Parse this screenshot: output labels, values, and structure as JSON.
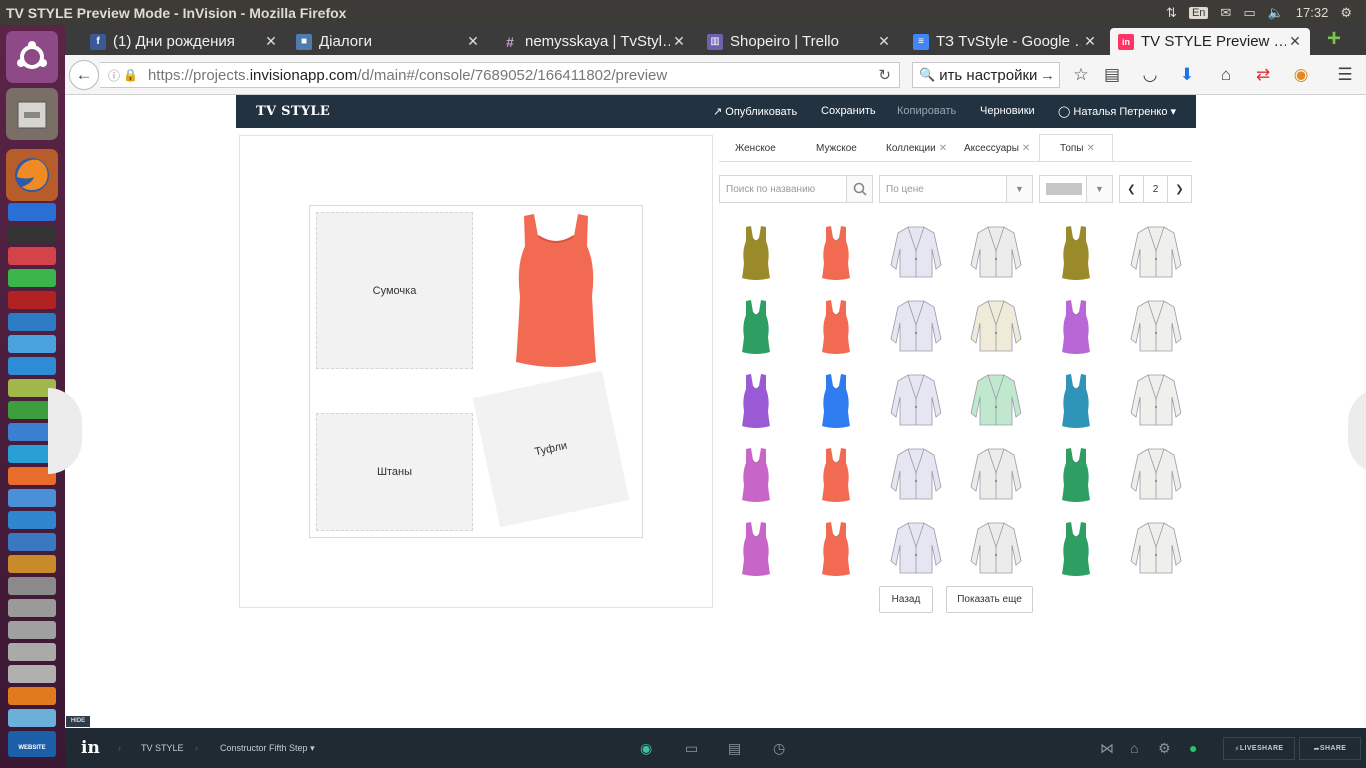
{
  "os": {
    "window_title": "TV STYLE Preview Mode - InVision - Mozilla Firefox",
    "keyboard_layout": "En",
    "clock": "17:32"
  },
  "launcher": {
    "icons": [
      "ubuntu-dash-icon",
      "files-icon",
      "firefox-icon",
      "webstorm-icon",
      "terminal-icon",
      "filezilla-icon",
      "libreoffice-icon",
      "software-center-icon",
      "website-copier-icon"
    ],
    "bottom_label": "WEBSITE COPIER"
  },
  "browser": {
    "tabs": [
      {
        "label": "(1) Дни рождения",
        "icon": "facebook-icon",
        "color": "#3b5998",
        "glyph": "f"
      },
      {
        "label": "Діалоги",
        "icon": "chat-icon",
        "color": "#4f7cae",
        "glyph": "■"
      },
      {
        "label": "nemysskaya | TvStyl…",
        "icon": "slack-icon",
        "color": "#6b4a6b",
        "glyph": "#"
      },
      {
        "label": "Shopeiro | Trello",
        "icon": "trello-icon",
        "color": "#7060b0",
        "glyph": "▥"
      },
      {
        "label": "ТЗ TvStyle - Google …",
        "icon": "google-docs-icon",
        "color": "#4285f4",
        "glyph": "≡"
      },
      {
        "label": "TV STYLE Preview …",
        "icon": "invision-icon",
        "color": "#ff3366",
        "glyph": "in"
      }
    ],
    "url_prefix": "https://projects.",
    "url_host": "invisionapp.com",
    "url_path": "/d/main#/console/7689052/166411802/preview",
    "search_value": "ить настройки"
  },
  "app": {
    "logo": "TV STYLE",
    "header": {
      "publish": "Опубликовать",
      "save": "Сохранить",
      "copy": "Копировать",
      "drafts": "Черновики",
      "user": "Наталья Петренко"
    },
    "slots": {
      "bag": "Сумочка",
      "pants": "Штаны",
      "shoes": "Туфли"
    },
    "categories": [
      {
        "label": "Женское",
        "closable": false
      },
      {
        "label": "Мужское",
        "closable": false
      },
      {
        "label": "Коллекции",
        "closable": true
      },
      {
        "label": "Аксессуары",
        "closable": true
      },
      {
        "label": "Топы",
        "closable": true
      }
    ],
    "filters": {
      "search_placeholder": "Поиск по названию",
      "price_placeholder": "По цене",
      "color_value": "#c6c6c6"
    },
    "pager": {
      "page": "2"
    },
    "grid": [
      [
        {
          "type": "tank",
          "color": "#9a8a2a"
        },
        {
          "type": "tank",
          "color": "#f26a52"
        },
        {
          "type": "blazer",
          "color": "#e6e6f2"
        },
        {
          "type": "blazer",
          "color": "#ececea"
        },
        {
          "type": "tank",
          "color": "#9a8a2a"
        },
        {
          "type": "blazer",
          "color": "#efefec"
        }
      ],
      [
        {
          "type": "tank",
          "color": "#2f9e62"
        },
        {
          "type": "tank",
          "color": "#f26a52"
        },
        {
          "type": "blazer",
          "color": "#e6e6f2"
        },
        {
          "type": "blazer",
          "color": "#f0ead8"
        },
        {
          "type": "tank",
          "color": "#b768d6"
        },
        {
          "type": "blazer",
          "color": "#efefec"
        }
      ],
      [
        {
          "type": "tank",
          "color": "#9a5ad6"
        },
        {
          "type": "tank",
          "color": "#2f7cf0"
        },
        {
          "type": "blazer",
          "color": "#e6e6f2"
        },
        {
          "type": "blazer",
          "color": "#bfe8cf"
        },
        {
          "type": "tank",
          "color": "#2f95b8"
        },
        {
          "type": "blazer",
          "color": "#efefec"
        }
      ],
      [
        {
          "type": "tank",
          "color": "#c865c8"
        },
        {
          "type": "tank",
          "color": "#f26a52"
        },
        {
          "type": "blazer",
          "color": "#e6e6f2"
        },
        {
          "type": "blazer",
          "color": "#ececea"
        },
        {
          "type": "tank",
          "color": "#2f9e62"
        },
        {
          "type": "blazer",
          "color": "#efefec"
        }
      ],
      [
        {
          "type": "tank",
          "color": "#c865c8"
        },
        {
          "type": "tank",
          "color": "#f26a52"
        },
        {
          "type": "blazer",
          "color": "#e6e6f2"
        },
        {
          "type": "blazer",
          "color": "#ececea"
        },
        {
          "type": "tank",
          "color": "#2f9e62"
        },
        {
          "type": "blazer",
          "color": "#efefec"
        }
      ]
    ],
    "featured_item_color": "#f26a52",
    "back_button": "Назад",
    "more_button": "Показать еще"
  },
  "invision_bar": {
    "hide_label": "HIDE",
    "project": "TV STYLE",
    "screen": "Constructor Fifth Step",
    "liveshare": "LIVESHARE",
    "share": "SHARE"
  }
}
